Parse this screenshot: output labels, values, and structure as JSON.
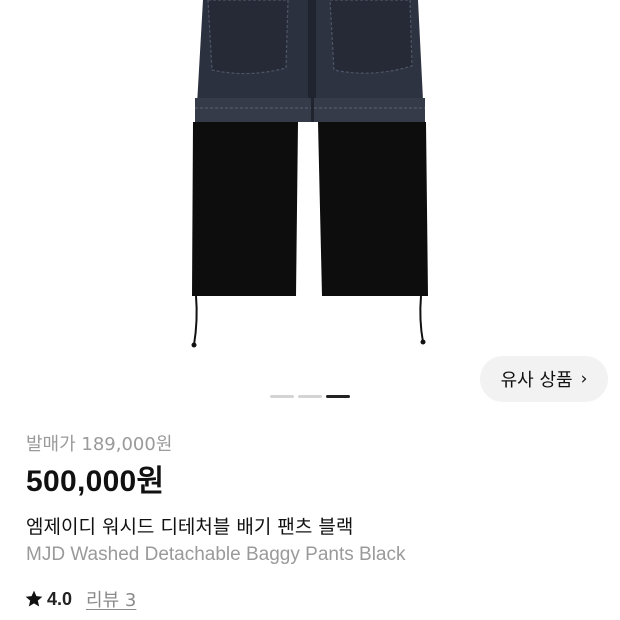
{
  "product": {
    "similar_label": "유사 상품",
    "similar_chevron": "›",
    "retail_price_text": "발매가 189,000원",
    "price_text": "500,000원",
    "name_ko": "엠제이디 워시드 디테처블 배기 팬츠 블랙",
    "name_en": "MJD Washed Detachable Baggy Pants Black",
    "rating": "4.0",
    "reviews_text": "리뷰 3"
  },
  "carousel": {
    "count": 3,
    "active_index": 2
  },
  "icons": {
    "star": "star-icon",
    "chevron": "chevron-right-icon"
  },
  "colors": {
    "denim": "#2c3140",
    "black_panel": "#0d0d0d",
    "accent_text": "#111111",
    "muted_text": "#9a9a9a",
    "button_bg": "#f2f2f2"
  }
}
